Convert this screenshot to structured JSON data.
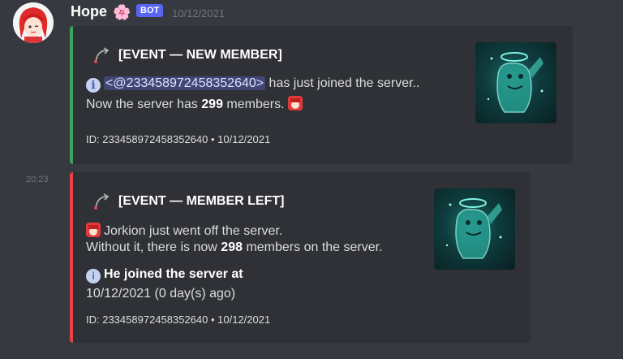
{
  "author": {
    "name": "Hope",
    "emoji": "🌸",
    "badge": "BOT",
    "timestamp": "10/12/2021"
  },
  "second_message_time": "20:23",
  "colors": {
    "join_accent": "#3ba55d",
    "leave_accent": "#ed4245",
    "mention_bg": "#414675"
  },
  "embed_join": {
    "title": "[EVENT — NEW MEMBER]",
    "info_icon": "ℹ",
    "mention": "<@233458972458352640>",
    "line1_rest": " has just joined the server..",
    "line2_prefix": "Now the server has ",
    "line2_count": "299",
    "line2_suffix": " members.",
    "footer": "ID: 233458972458352640 • 10/12/2021"
  },
  "embed_leave": {
    "title": "[EVENT — MEMBER LEFT]",
    "line1": "Jorkion just went off the server.",
    "line2_prefix": "Without it, there is now ",
    "line2_count": "298",
    "line2_suffix": " members on the server.",
    "field_name": "He joined the server at",
    "field_value": "10/12/2021 (0 day(s) ago)",
    "footer": "ID: 233458972458352640 • 10/12/2021"
  }
}
